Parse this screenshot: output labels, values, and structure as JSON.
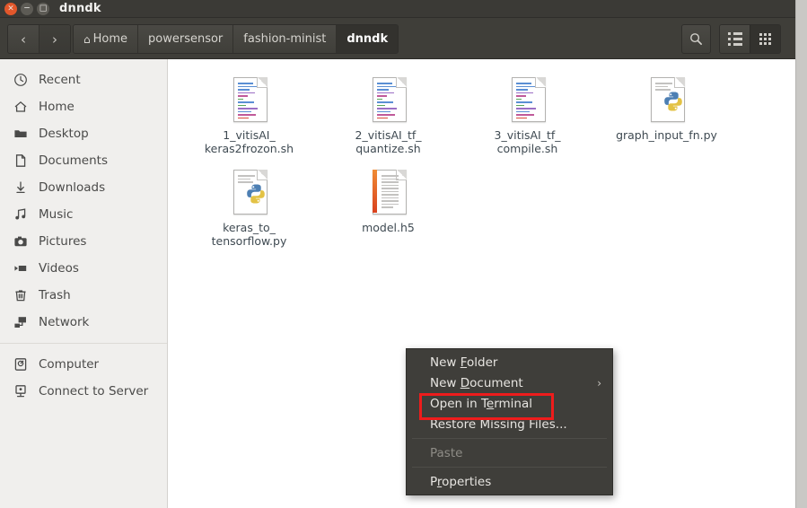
{
  "window": {
    "title": "dnndk",
    "buttons": [
      {
        "name": "close",
        "glyph": "×"
      },
      {
        "name": "minimize",
        "glyph": "−"
      },
      {
        "name": "maximize",
        "glyph": "□"
      }
    ]
  },
  "toolbar": {
    "back_label": "‹",
    "forward_label": "›",
    "breadcrumbs": [
      {
        "label": "Home",
        "icon": "home-icon",
        "active": false
      },
      {
        "label": "powersensor",
        "active": false
      },
      {
        "label": "fashion-minist",
        "active": false
      },
      {
        "label": "dnndk",
        "active": true
      }
    ],
    "search_icon": "search-icon",
    "view_list_icon": "list-view-icon",
    "view_grid_icon": "grid-view-icon",
    "active_view": "grid"
  },
  "sidebar": {
    "items": [
      {
        "label": "Recent",
        "icon": "clock-icon"
      },
      {
        "label": "Home",
        "icon": "home-icon"
      },
      {
        "label": "Desktop",
        "icon": "folder-icon"
      },
      {
        "label": "Documents",
        "icon": "document-icon"
      },
      {
        "label": "Downloads",
        "icon": "download-icon"
      },
      {
        "label": "Music",
        "icon": "music-note-icon"
      },
      {
        "label": "Pictures",
        "icon": "camera-icon"
      },
      {
        "label": "Videos",
        "icon": "video-icon"
      },
      {
        "label": "Trash",
        "icon": "trash-icon"
      },
      {
        "label": "Network",
        "icon": "network-icon"
      }
    ],
    "items2": [
      {
        "label": "Computer",
        "icon": "computer-icon"
      },
      {
        "label": "Connect to Server",
        "icon": "server-icon"
      }
    ]
  },
  "files": [
    {
      "name": "1_vitisAI_\nkeras2frozon.sh",
      "type": "shell-script",
      "icon": "script-file-icon"
    },
    {
      "name": "2_vitisAI_tf_\nquantize.sh",
      "type": "shell-script",
      "icon": "script-file-icon"
    },
    {
      "name": "3_vitisAI_tf_\ncompile.sh",
      "type": "shell-script",
      "icon": "script-file-icon"
    },
    {
      "name": "graph_input_fn.py",
      "type": "python",
      "icon": "python-file-icon"
    },
    {
      "name": "keras_to_\ntensorflow.py",
      "type": "python",
      "icon": "python-file-icon"
    },
    {
      "name": "model.h5",
      "type": "data",
      "icon": "text-file-icon"
    }
  ],
  "context_menu": {
    "items": [
      {
        "label": "New Folder",
        "mnemonic": "F",
        "disabled": false,
        "submenu": false,
        "separator_after": false
      },
      {
        "label": "New Document",
        "mnemonic": "D",
        "disabled": false,
        "submenu": true,
        "separator_after": false
      },
      {
        "label": "Open in Terminal",
        "mnemonic": "e",
        "disabled": false,
        "submenu": false,
        "separator_after": false,
        "highlighted": true
      },
      {
        "label": "Restore Missing Files...",
        "mnemonic": "",
        "disabled": false,
        "submenu": false,
        "separator_after": true
      },
      {
        "label": "Paste",
        "mnemonic": "",
        "disabled": true,
        "submenu": false,
        "separator_after": true
      },
      {
        "label": "Properties",
        "mnemonic": "r",
        "disabled": false,
        "submenu": false,
        "separator_after": false
      }
    ],
    "submenu_arrow": "›"
  },
  "colors": {
    "titlebar": "#3b3a36",
    "toolbar": "#3f3e39",
    "sidebar": "#f0efed",
    "menu_bg": "#3f3e3a",
    "highlight_red": "#ee1c1c",
    "close_button": "#e2572b",
    "label_text": "#3f4a52"
  }
}
